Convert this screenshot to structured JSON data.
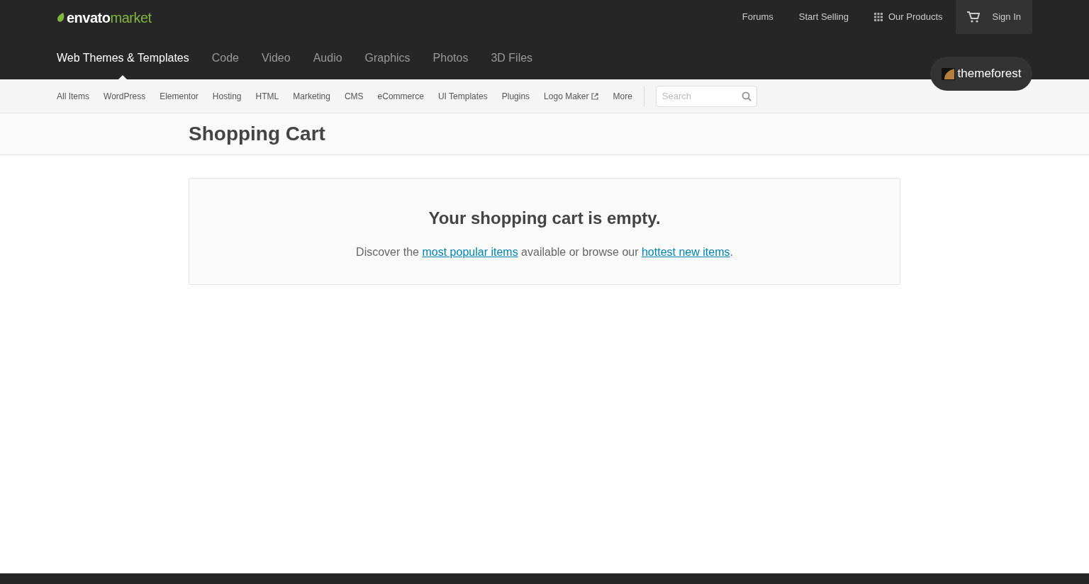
{
  "logo": {
    "brand": "envato",
    "product": "market"
  },
  "top_links": [
    {
      "label": "Forums",
      "kind": "text"
    },
    {
      "label": "Start Selling",
      "kind": "text"
    },
    {
      "label": "Our Products",
      "kind": "grid"
    }
  ],
  "sign_in": {
    "label": "Sign In"
  },
  "categories": [
    {
      "label": "Web Themes & Templates",
      "selected": true
    },
    {
      "label": "Code",
      "selected": false
    },
    {
      "label": "Video",
      "selected": false
    },
    {
      "label": "Audio",
      "selected": false
    },
    {
      "label": "Graphics",
      "selected": false
    },
    {
      "label": "Photos",
      "selected": false
    },
    {
      "label": "3D Files",
      "selected": false
    }
  ],
  "site_badge": {
    "label": "themeforest"
  },
  "subnav": [
    {
      "label": "All Items",
      "kind": "link"
    },
    {
      "label": "WordPress",
      "kind": "link"
    },
    {
      "label": "Elementor",
      "kind": "link"
    },
    {
      "label": "Hosting",
      "kind": "link"
    },
    {
      "label": "HTML",
      "kind": "link"
    },
    {
      "label": "Marketing",
      "kind": "link"
    },
    {
      "label": "CMS",
      "kind": "link"
    },
    {
      "label": "eCommerce",
      "kind": "link"
    },
    {
      "label": "UI Templates",
      "kind": "link"
    },
    {
      "label": "Plugins",
      "kind": "link"
    },
    {
      "label": "Logo Maker",
      "kind": "external"
    },
    {
      "label": "More",
      "kind": "link"
    }
  ],
  "search": {
    "placeholder": "Search"
  },
  "page_title": "Shopping Cart",
  "empty_cart": {
    "heading": "Your shopping cart is empty.",
    "message": [
      {
        "kind": "text",
        "text": "Discover the "
      },
      {
        "kind": "link",
        "text": "most popular items"
      },
      {
        "kind": "text",
        "text": " available or browse our "
      },
      {
        "kind": "link",
        "text": "hottest new items"
      },
      {
        "kind": "text",
        "text": "."
      }
    ]
  }
}
